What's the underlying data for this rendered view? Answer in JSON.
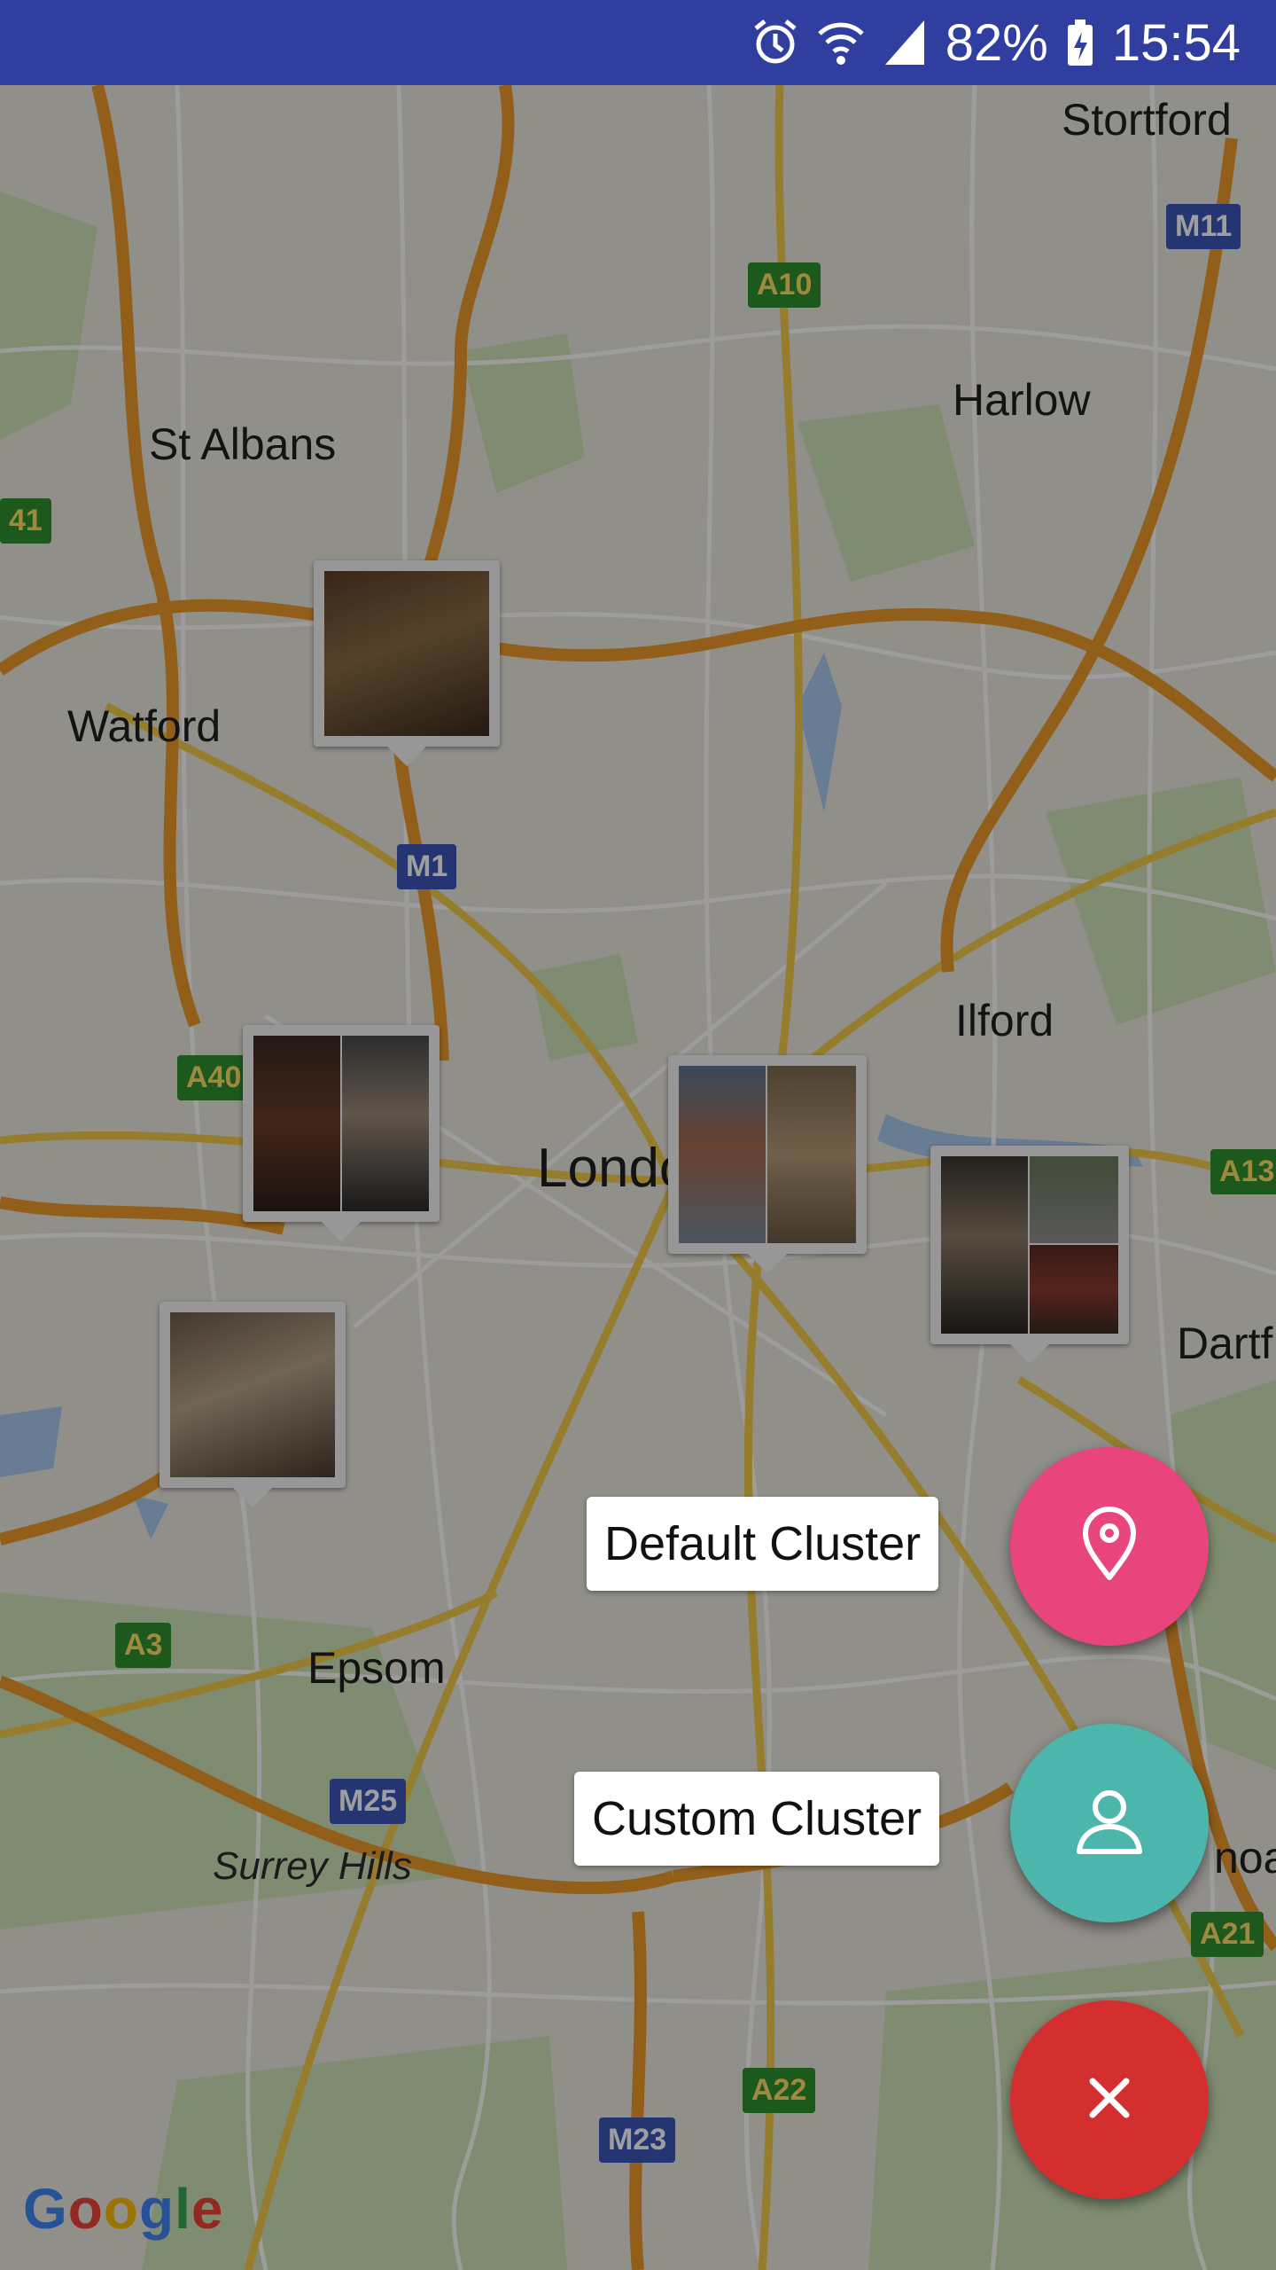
{
  "status_bar": {
    "battery_percent": "82%",
    "time": "15:54",
    "icons": [
      "alarm-icon",
      "wifi-icon",
      "signal-icon",
      "battery-charging-icon"
    ]
  },
  "map": {
    "places": [
      "Stortford",
      "Harlow",
      "St Albans",
      "Watford",
      "Ilford",
      "London",
      "Dartf",
      "Epsom",
      "Surrey Hills",
      "noa"
    ],
    "roads": [
      "M11",
      "A10",
      "41",
      "M1",
      "A40",
      "A13",
      "A3",
      "M25",
      "A21",
      "A22",
      "M23"
    ],
    "attribution": "Google"
  },
  "fab_menu": {
    "default_cluster_label": "Default Cluster",
    "custom_cluster_label": "Custom Cluster",
    "icons": [
      "map-pin-icon",
      "person-icon",
      "close-icon"
    ],
    "colors": {
      "pin": "#e8457d",
      "person": "#4db6ac",
      "close": "#d32f2f"
    }
  }
}
